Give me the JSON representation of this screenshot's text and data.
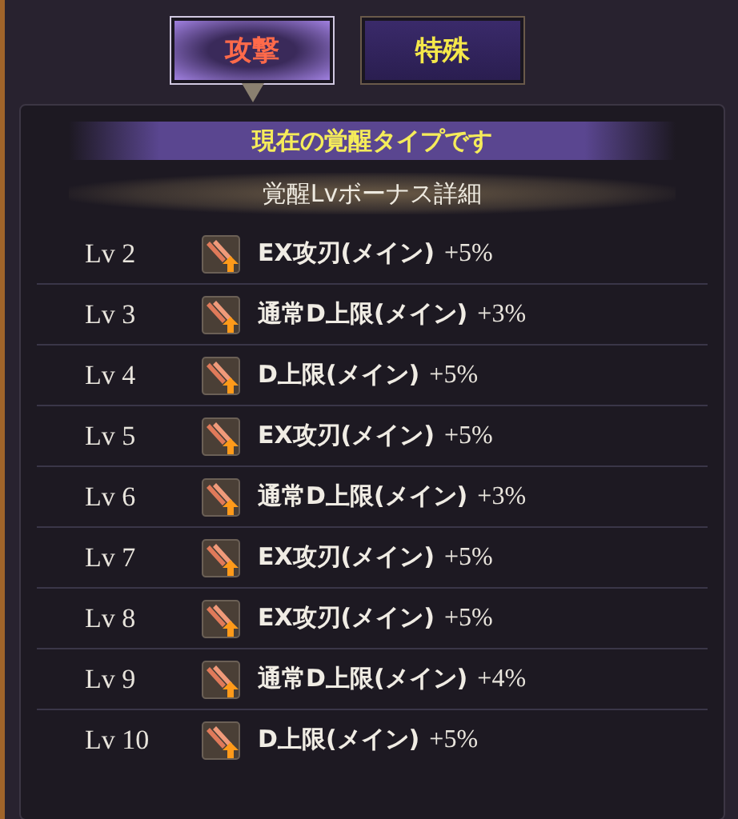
{
  "tabs": [
    {
      "label": "攻撃",
      "selected": true
    },
    {
      "label": "特殊",
      "selected": false
    }
  ],
  "banner": "現在の覚醒タイプです",
  "section_title": "覚醒Lvボーナス詳細",
  "rows": [
    {
      "level": "Lv 2",
      "label": "EX攻刃(メイン)",
      "bonus": "+5%"
    },
    {
      "level": "Lv 3",
      "label": "通常D上限(メイン)",
      "bonus": "+3%"
    },
    {
      "level": "Lv 4",
      "label": "D上限(メイン)",
      "bonus": "+5%"
    },
    {
      "level": "Lv 5",
      "label": "EX攻刃(メイン)",
      "bonus": "+5%"
    },
    {
      "level": "Lv 6",
      "label": "通常D上限(メイン)",
      "bonus": "+3%"
    },
    {
      "level": "Lv 7",
      "label": "EX攻刃(メイン)",
      "bonus": "+5%"
    },
    {
      "level": "Lv 8",
      "label": "EX攻刃(メイン)",
      "bonus": "+5%"
    },
    {
      "level": "Lv 9",
      "label": "通常D上限(メイン)",
      "bonus": "+4%"
    },
    {
      "level": "Lv 10",
      "label": "D上限(メイン)",
      "bonus": "+5%"
    }
  ]
}
